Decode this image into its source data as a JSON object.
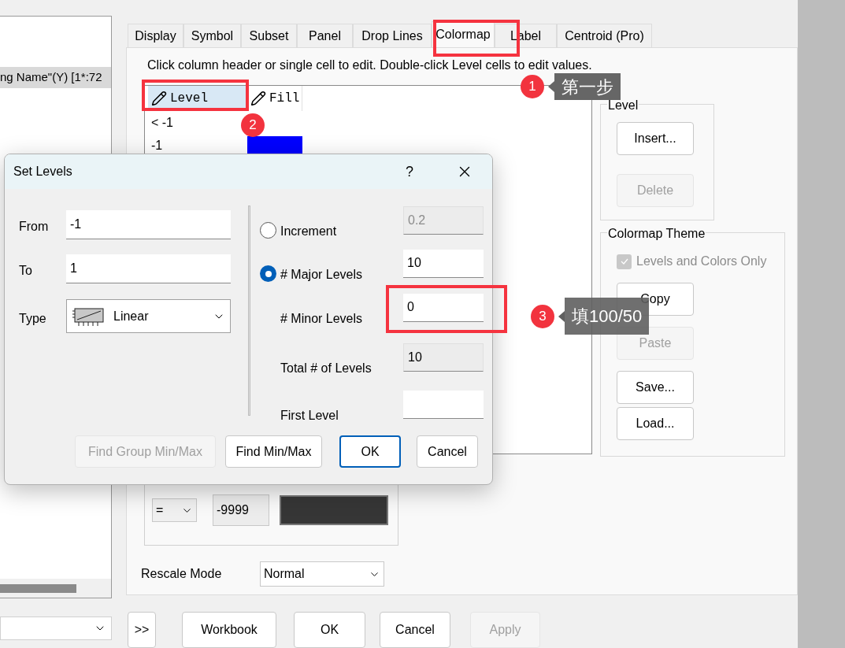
{
  "sidebar": {
    "items": [
      {
        "text": "ng Name\"(Y) [1*:72",
        "selected": true
      }
    ]
  },
  "tabs": [
    {
      "label": "Display",
      "selected": false
    },
    {
      "label": "Symbol",
      "selected": false
    },
    {
      "label": "Subset",
      "selected": false
    },
    {
      "label": "Panel",
      "selected": false
    },
    {
      "label": "Drop Lines",
      "selected": false
    },
    {
      "label": "Colormap",
      "selected": true
    },
    {
      "label": "Label",
      "selected": false
    },
    {
      "label": "Centroid (Pro)",
      "selected": false
    }
  ],
  "instruction": "Click column header or single cell to edit. Double-click Level cells to edit values.",
  "grid": {
    "columns": [
      {
        "label": "Level",
        "selected": true
      },
      {
        "label": "Fill",
        "selected": false
      }
    ],
    "rows": [
      {
        "level": "< -1"
      },
      {
        "level": "-1",
        "color": "#0000ff"
      }
    ]
  },
  "level_group": {
    "title": "Level",
    "buttons": [
      {
        "label": "Insert...",
        "disabled": false
      },
      {
        "label": "Delete",
        "disabled": true
      }
    ]
  },
  "theme_group": {
    "title": "Colormap Theme",
    "checkbox": {
      "label": "Levels and Colors Only",
      "checked": true,
      "disabled": true
    },
    "buttons": [
      {
        "label": "Copy",
        "disabled": false
      },
      {
        "label": "Paste",
        "disabled": true
      },
      {
        "label": "Save...",
        "disabled": false
      },
      {
        "label": "Load...",
        "disabled": false
      }
    ]
  },
  "missing": {
    "operator": "=",
    "value": "-9999"
  },
  "rescale": {
    "label": "Rescale Mode",
    "value": "Normal"
  },
  "buttons": [
    {
      "label": ">>",
      "disabled": false
    },
    {
      "label": "Workbook",
      "disabled": false
    },
    {
      "label": "OK",
      "disabled": false
    },
    {
      "label": "Cancel",
      "disabled": false
    },
    {
      "label": "Apply",
      "disabled": true
    }
  ],
  "set_levels": {
    "title": "Set Levels",
    "help": "?",
    "fields": [
      {
        "label": "From",
        "value": "-1"
      },
      {
        "label": "To",
        "value": "1"
      }
    ],
    "type": {
      "label": "Type",
      "value": "Linear"
    },
    "options": [
      {
        "kind": "radio",
        "label": "Increment",
        "selected": false,
        "value": "0.2",
        "disabled": true
      },
      {
        "kind": "radio",
        "label": "# Major Levels",
        "selected": true,
        "value": "10",
        "disabled": false
      },
      {
        "kind": "field",
        "label": "# Minor Levels",
        "value": "0",
        "disabled": false
      },
      {
        "kind": "field",
        "label": "Total # of Levels",
        "value": "10",
        "disabled": true
      },
      {
        "kind": "field",
        "label": "First Level",
        "disabled": false
      }
    ],
    "buttons": [
      {
        "label": "Find Group Min/Max",
        "disabled": true,
        "default": false
      },
      {
        "label": "Find Min/Max",
        "disabled": false,
        "default": false
      },
      {
        "label": "OK",
        "disabled": false,
        "default": true
      },
      {
        "label": "Cancel",
        "disabled": false,
        "default": false
      }
    ]
  },
  "annotations": [
    {
      "number": "1",
      "text": "第一步"
    },
    {
      "number": "2"
    },
    {
      "number": "3",
      "text": "填100/50"
    }
  ]
}
